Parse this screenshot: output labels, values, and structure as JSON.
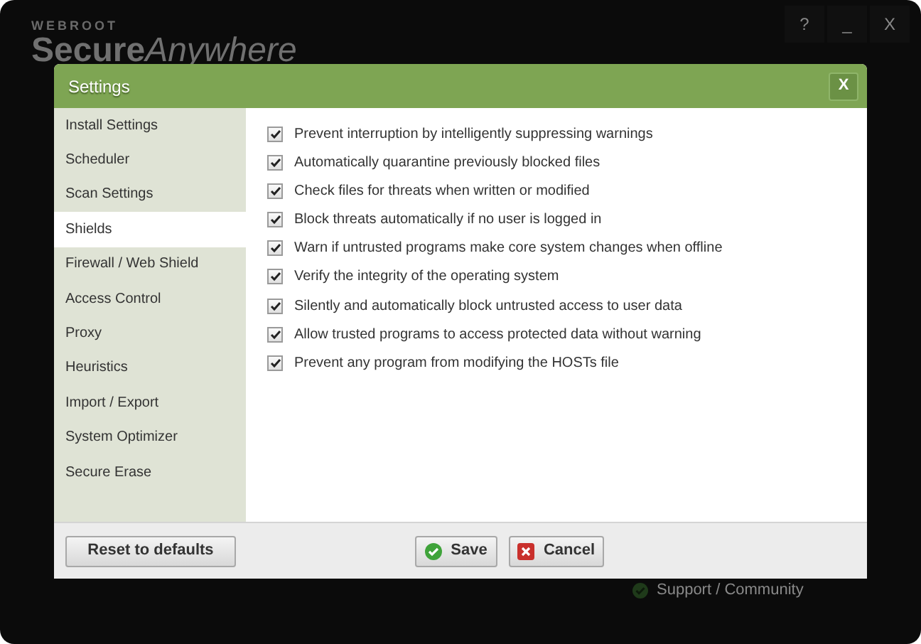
{
  "app": {
    "brand": "WEBROOT",
    "product_bold": "Secure",
    "product_light": "Anywhere",
    "window_buttons": [
      "?",
      "_",
      "X"
    ],
    "support_link": "Support / Community"
  },
  "dialog": {
    "title": "Settings",
    "close": "X",
    "sidebar": {
      "items": [
        {
          "label": "Install Settings",
          "selected": false
        },
        {
          "label": "Scheduler",
          "selected": false
        },
        {
          "label": "Scan Settings",
          "selected": false
        },
        {
          "label": "Shields",
          "selected": true
        },
        {
          "label": "Firewall / Web Shield",
          "selected": false
        },
        {
          "label": "Access Control",
          "selected": false
        },
        {
          "label": "Proxy",
          "selected": false
        },
        {
          "label": "Heuristics",
          "selected": false
        },
        {
          "label": "Import / Export",
          "selected": false
        },
        {
          "label": "System Optimizer",
          "selected": false
        },
        {
          "label": "Secure Erase",
          "selected": false
        }
      ]
    },
    "options": [
      {
        "label": "Prevent interruption by intelligently suppressing warnings",
        "checked": true
      },
      {
        "label": "Automatically quarantine previously blocked files",
        "checked": true
      },
      {
        "label": "Check files for threats when written or modified",
        "checked": true
      },
      {
        "label": "Block threats automatically if no user is logged in",
        "checked": true
      },
      {
        "label": "Warn if untrusted programs make core system changes when offline",
        "checked": true
      },
      {
        "label": "Verify the integrity of the operating system",
        "checked": true
      },
      {
        "label": "Silently and automatically block untrusted access to user data",
        "checked": true
      },
      {
        "label": "Allow trusted programs to access protected data without warning",
        "checked": true
      },
      {
        "label": "Prevent any program from modifying the HOSTs file",
        "checked": true
      }
    ],
    "buttons": {
      "reset": "Reset to defaults",
      "save": "Save",
      "cancel": "Cancel"
    }
  }
}
